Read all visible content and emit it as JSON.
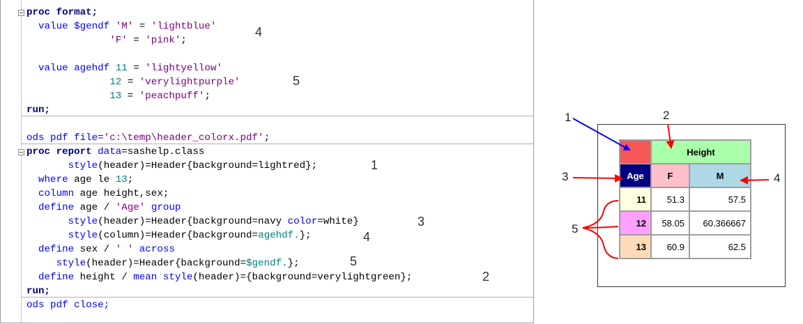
{
  "code": {
    "line1": {
      "kw": "proc format;"
    },
    "line2": {
      "a": "value $gendf ",
      "b": "'M'",
      "c": " = ",
      "d": "'lightblue'"
    },
    "line3": {
      "b": "'F'",
      "c": " = ",
      "d": "'pink'",
      "e": ";"
    },
    "line5": {
      "a": "value agehdf ",
      "b": "11",
      "c": " = ",
      "d": "'lightyellow'"
    },
    "line6": {
      "b": "12",
      "c": " = ",
      "d": "'verylightpurple'"
    },
    "line7": {
      "b": "13",
      "c": " = ",
      "d": "'peachpuff'",
      "e": ";"
    },
    "line8": {
      "kw": "run;"
    },
    "line10": {
      "a": "ods pdf file=",
      "b": "'c:\\temp\\header_colorx.pdf'",
      "c": ";"
    },
    "line11": {
      "kw": "proc report ",
      "b": "data",
      "c": "=sashelp.class"
    },
    "line12": {
      "b": "style",
      "c": "(header)=Header{background=lightred};"
    },
    "line13": {
      "b": "where",
      "c": " age le ",
      "d": "13",
      "e": ";"
    },
    "line14": {
      "b": "column",
      "c": " age height,sex;"
    },
    "line15": {
      "b": "define",
      "c": " age / ",
      "d": "'Age'",
      "e": " group"
    },
    "line16": {
      "b": "style",
      "c": "(header)=Header{background=navy ",
      "d": "color",
      "e": "=white}"
    },
    "line17": {
      "b": "style",
      "c": "(column)=Header{background=",
      "d": "agehdf.",
      "e": "};"
    },
    "line18": {
      "b": "define",
      "c": " sex / ",
      "d": "' '",
      "e": " across"
    },
    "line19": {
      "b": "style",
      "c": "(header)=Header{background=",
      "d": "$gendf.",
      "e": "};"
    },
    "line20": {
      "b": "define",
      "c": " height / ",
      "d": "mean",
      "e": " ",
      "f": "style",
      "g": "(header)={background=verylightgreen};"
    },
    "line21": {
      "kw": "run;"
    },
    "line22": {
      "a": "ods pdf close;"
    }
  },
  "code_annotations": {
    "n4a": "4",
    "n5a": "5",
    "n1": "1",
    "n3": "3",
    "n4b": "4",
    "n5b": "5",
    "n2": "2"
  },
  "report": {
    "header_top": "Height",
    "age_header": "Age",
    "f_header": "F",
    "m_header": "M",
    "rows": [
      {
        "age": "11",
        "f": "51.3",
        "m": "57.5",
        "color": "#ffffe0"
      },
      {
        "age": "12",
        "f": "58.05",
        "m": "60.366667",
        "color": "#ffa0ff"
      },
      {
        "age": "13",
        "f": "60.9",
        "m": "62.5",
        "color": "#ffdab9"
      }
    ],
    "colors": {
      "empty": "#f75757",
      "height": "#aaffaa",
      "age": "#000080",
      "f": "#ffc0cb",
      "m": "#add8e6"
    }
  },
  "output_labels": {
    "l1": "1",
    "l2": "2",
    "l3": "3",
    "l4": "4",
    "l5": "5"
  }
}
